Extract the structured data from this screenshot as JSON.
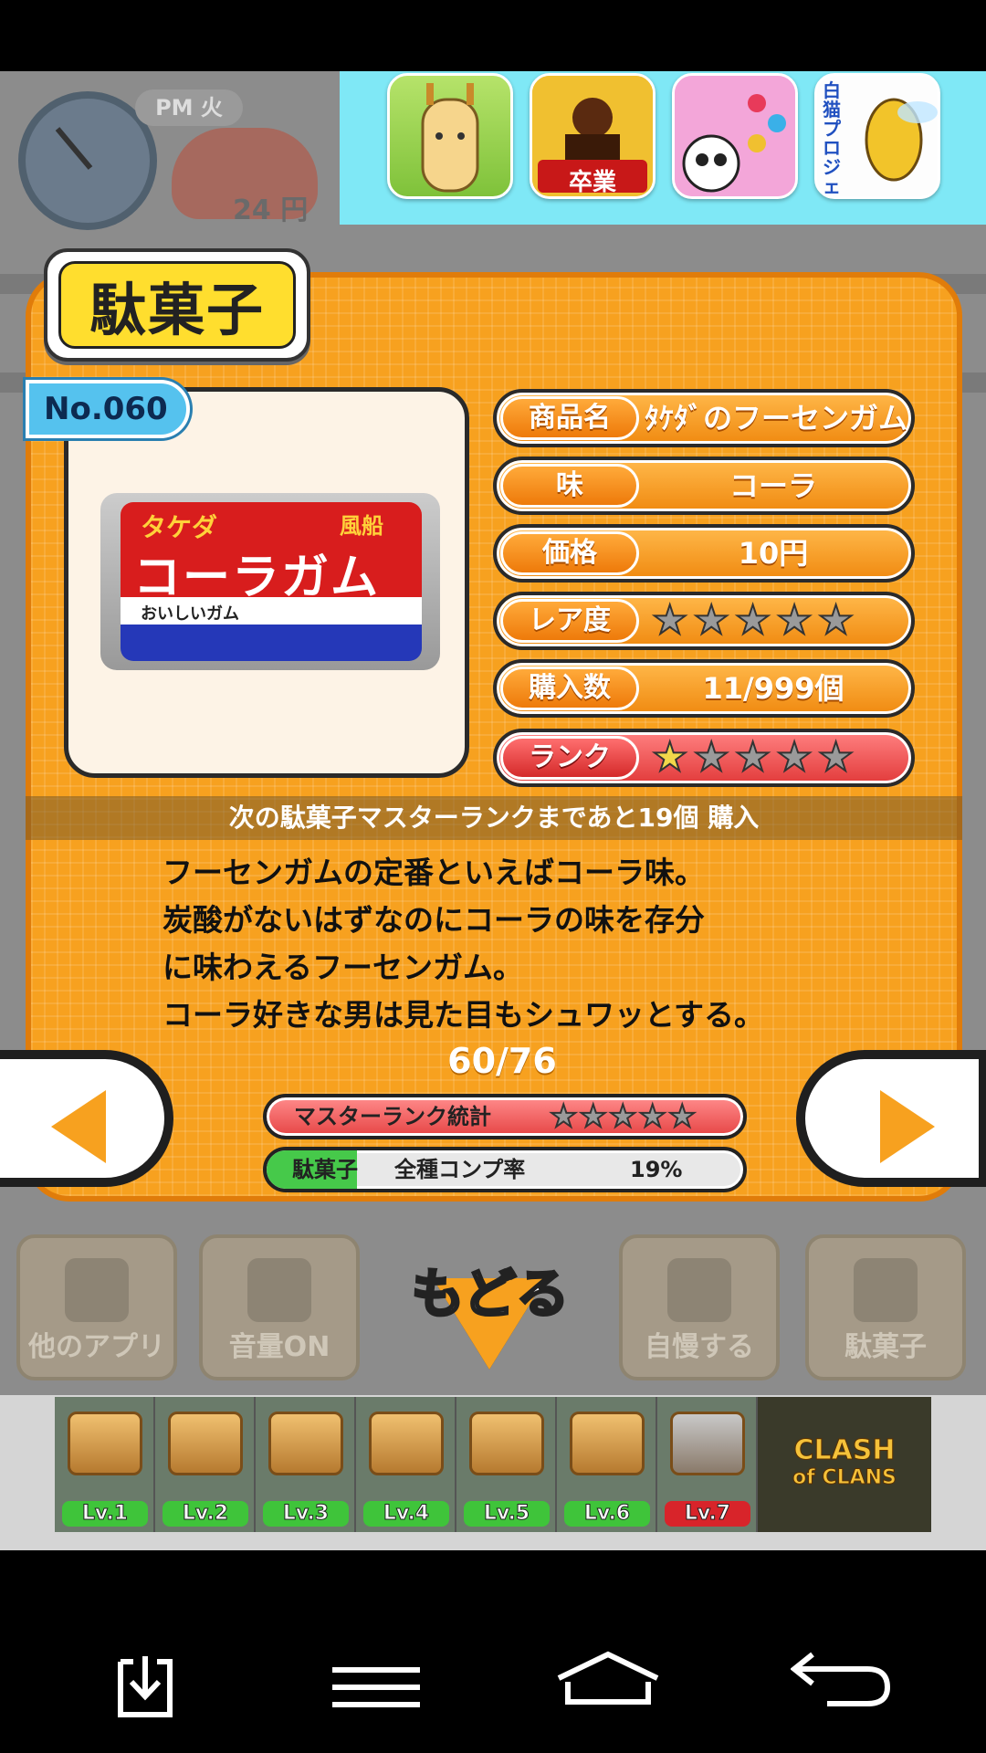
{
  "background": {
    "clock_label": "PM 火",
    "money": "24 円"
  },
  "ad_banner": {
    "icons": [
      {
        "name": "giraffe-app-icon",
        "text": ""
      },
      {
        "name": "graduation-game-icon",
        "text": "卒業"
      },
      {
        "name": "panda-puzzle-icon",
        "text": ""
      },
      {
        "name": "shironeko-project-icon",
        "text": "白猫プロジェクト"
      }
    ]
  },
  "panel": {
    "title": "駄菓子",
    "number": "No.060",
    "item_image": {
      "brand": "タケダ",
      "maker": "風船",
      "name": "コーラガム",
      "sub": "おいしいガム"
    },
    "info": [
      {
        "label": "商品名",
        "value": "ﾀｹﾀﾞのフーセンガム"
      },
      {
        "label": "味",
        "value": "コーラ"
      },
      {
        "label": "価格",
        "value": "10円"
      },
      {
        "label": "レア度",
        "value": "",
        "stars": 0
      },
      {
        "label": "購入数",
        "value": "11/999個"
      },
      {
        "label": "ランク",
        "value": "",
        "stars": 1
      }
    ],
    "next_rank_message": "次の駄菓子マスターランクまであと19個 購入",
    "description": [
      "フーセンガムの定番といえばコーラ味。",
      "炭酸がないはずなのにコーラの味を存分",
      "に味わえるフーセンガム。",
      "コーラ好きな男は見た目もシュワッとする。"
    ],
    "page_counter": "60/76",
    "master_stats": {
      "label": "マスターランク統計",
      "stars": 0,
      "max_stars": 5
    },
    "completion": {
      "label1": "駄菓子",
      "label2": "全種コンプ率",
      "percent": "19%",
      "rate": 0.19
    }
  },
  "menu": {
    "other_apps": "他のアプリ",
    "volume": "音量ON",
    "back": "もどる",
    "brag": "自慢する",
    "dagashi": "駄菓子"
  },
  "bottom_ad": {
    "levels": [
      "Lv.1",
      "Lv.2",
      "Lv.3",
      "Lv.4",
      "Lv.5",
      "Lv.6",
      "Lv.7"
    ],
    "logo_line1": "CLASH",
    "logo_line2": "of CLANS"
  },
  "colors": {
    "panel_orange": "#f7a11f",
    "rank_red": "#e23b3b",
    "ad_cyan": "#7fe8f6",
    "completion_green": "#46c94a"
  }
}
